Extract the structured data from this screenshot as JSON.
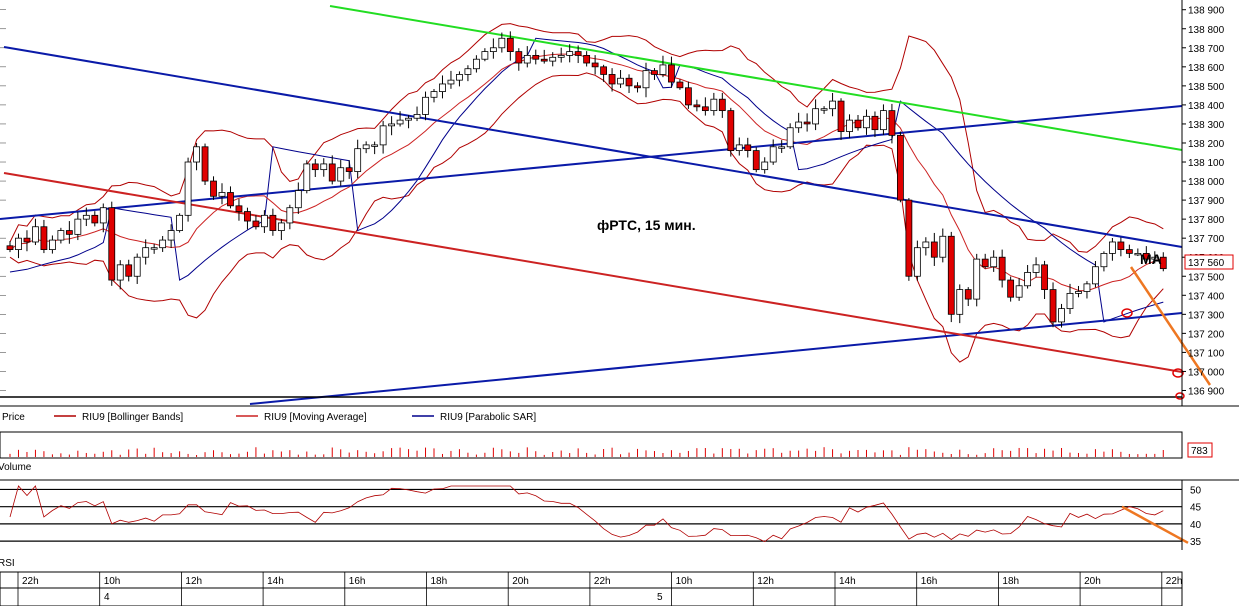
{
  "chart_data": {
    "type": "candlestick",
    "annotation": "фРТС,  15 мин.",
    "ma_label": "MA",
    "price_axis": {
      "min": 136850,
      "max": 138930,
      "ticks": [
        "138 900",
        "138 800",
        "138 700",
        "138 600",
        "138 500",
        "138 400",
        "138 300",
        "138 200",
        "138 100",
        "138 000",
        "137 900",
        "137 800",
        "137 700",
        "137 600",
        "137 500",
        "137 400",
        "137 300",
        "137 200",
        "137 100",
        "137 000",
        "136 900"
      ],
      "last_price": "137 560"
    },
    "legend": [
      {
        "label": "Price",
        "color": "#000000"
      },
      {
        "label": "RIU9 [Bollinger Bands]",
        "color": "#b00000"
      },
      {
        "label": "RIU9 [Moving Average]",
        "color": "#cc2222"
      },
      {
        "label": "RIU9 [Parabolic SAR]",
        "color": "#00008b"
      }
    ],
    "volume_panel": {
      "label": "Volume",
      "last_value": "783"
    },
    "rsi_panel": {
      "label": "RSI",
      "ticks": [
        "50",
        "45",
        "40",
        "35"
      ],
      "min": 33,
      "max": 51
    },
    "time_axis": {
      "labels": [
        "22h",
        "10h",
        "12h",
        "14h",
        "16h",
        "18h",
        "20h",
        "22h",
        "10h",
        "12h",
        "14h",
        "16h",
        "18h",
        "20h",
        "22h"
      ],
      "dates": [
        "4",
        "5"
      ]
    },
    "colors": {
      "up": "#ffffff",
      "down": "#e00000",
      "bb": "#b00000",
      "ma": "#cc2222",
      "sar": "#00008b",
      "green": "#22dd22",
      "orange": "#ee7722"
    },
    "closes": [
      137640,
      137700,
      137680,
      137760,
      137640,
      137690,
      137740,
      137720,
      137800,
      137820,
      137780,
      137860,
      137480,
      137560,
      137500,
      137600,
      137650,
      137650,
      137690,
      137740,
      137820,
      138100,
      138180,
      138000,
      137920,
      137940,
      137870,
      137840,
      137790,
      137760,
      137820,
      137740,
      137780,
      137860,
      137950,
      138090,
      138060,
      138090,
      138000,
      138070,
      138050,
      138170,
      138190,
      138190,
      138290,
      138300,
      138320,
      138330,
      138350,
      138440,
      138470,
      138510,
      138530,
      138560,
      138590,
      138640,
      138680,
      138700,
      138750,
      138680,
      138620,
      138660,
      138640,
      138630,
      138650,
      138660,
      138680,
      138660,
      138620,
      138600,
      138560,
      138510,
      138540,
      138500,
      138490,
      138580,
      138560,
      138610,
      138520,
      138490,
      138400,
      138390,
      138370,
      138430,
      138370,
      138160,
      138190,
      138160,
      138060,
      138100,
      138180,
      138180,
      138280,
      138310,
      138300,
      138380,
      138380,
      138420,
      138260,
      138320,
      138280,
      138340,
      138270,
      138370,
      138240,
      137900,
      137500,
      137650,
      137680,
      137600,
      137710,
      137300,
      137430,
      137380,
      137590,
      137550,
      137600,
      137480,
      137390,
      137450,
      137520,
      137560,
      137430,
      137260,
      137330,
      137410,
      137420,
      137460,
      137550,
      137620,
      137680,
      137640,
      137620,
      137620,
      137590,
      137600,
      137540
    ]
  }
}
